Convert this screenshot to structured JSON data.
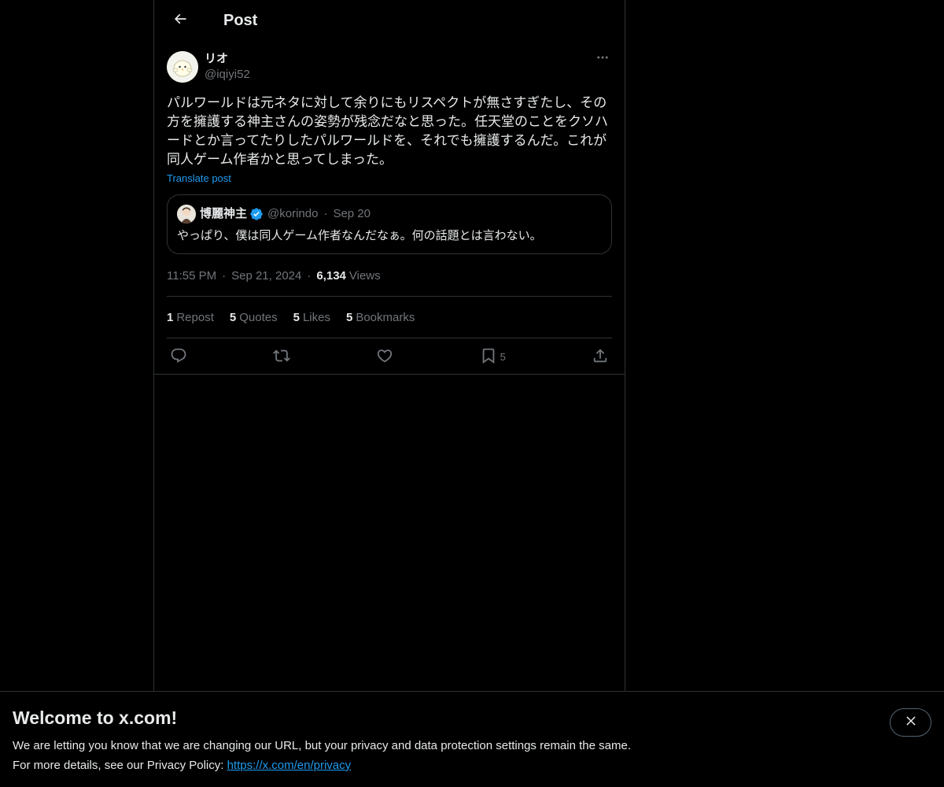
{
  "header": {
    "title": "Post",
    "back_icon": "arrow-left-icon"
  },
  "post": {
    "display_name": "リオ",
    "handle": "@iqiyi52",
    "text": "パルワールドは元ネタに対して余りにもリスペクトが無さすぎたし、その方を擁護する神主さんの姿勢が残念だなと思った。任天堂のことをクソハードとか言ってたりしたパルワールドを、それでも擁護するんだ。これが同人ゲーム作者かと思ってしまった。",
    "translate_label": "Translate post",
    "time": "11:55 PM",
    "date": "Sep 21, 2024",
    "views_count": "6,134",
    "views_label": "Views"
  },
  "quote": {
    "display_name": "博麗神主",
    "handle": "@korindo",
    "date": "Sep 20",
    "text": "やっぱり、僕は同人ゲーム作者なんだなぁ。何の話題とは言わない。"
  },
  "stats": {
    "reposts_count": "1",
    "reposts_label": "Repost",
    "quotes_count": "5",
    "quotes_label": "Quotes",
    "likes_count": "5",
    "likes_label": "Likes",
    "bookmarks_count": "5",
    "bookmarks_label": "Bookmarks"
  },
  "actions": {
    "bookmark_count": "5"
  },
  "banner": {
    "title": "Welcome to x.com!",
    "line1": "We are letting you know that we are changing our URL, but your privacy and data protection settings remain the same.",
    "line2_prefix": "For more details, see our Privacy Policy: ",
    "link": "https://x.com/en/privacy"
  },
  "colors": {
    "accent": "#1d9bf0",
    "muted": "#71767b",
    "text": "#e7e9ea",
    "border": "#2f3336",
    "background": "#000000"
  }
}
